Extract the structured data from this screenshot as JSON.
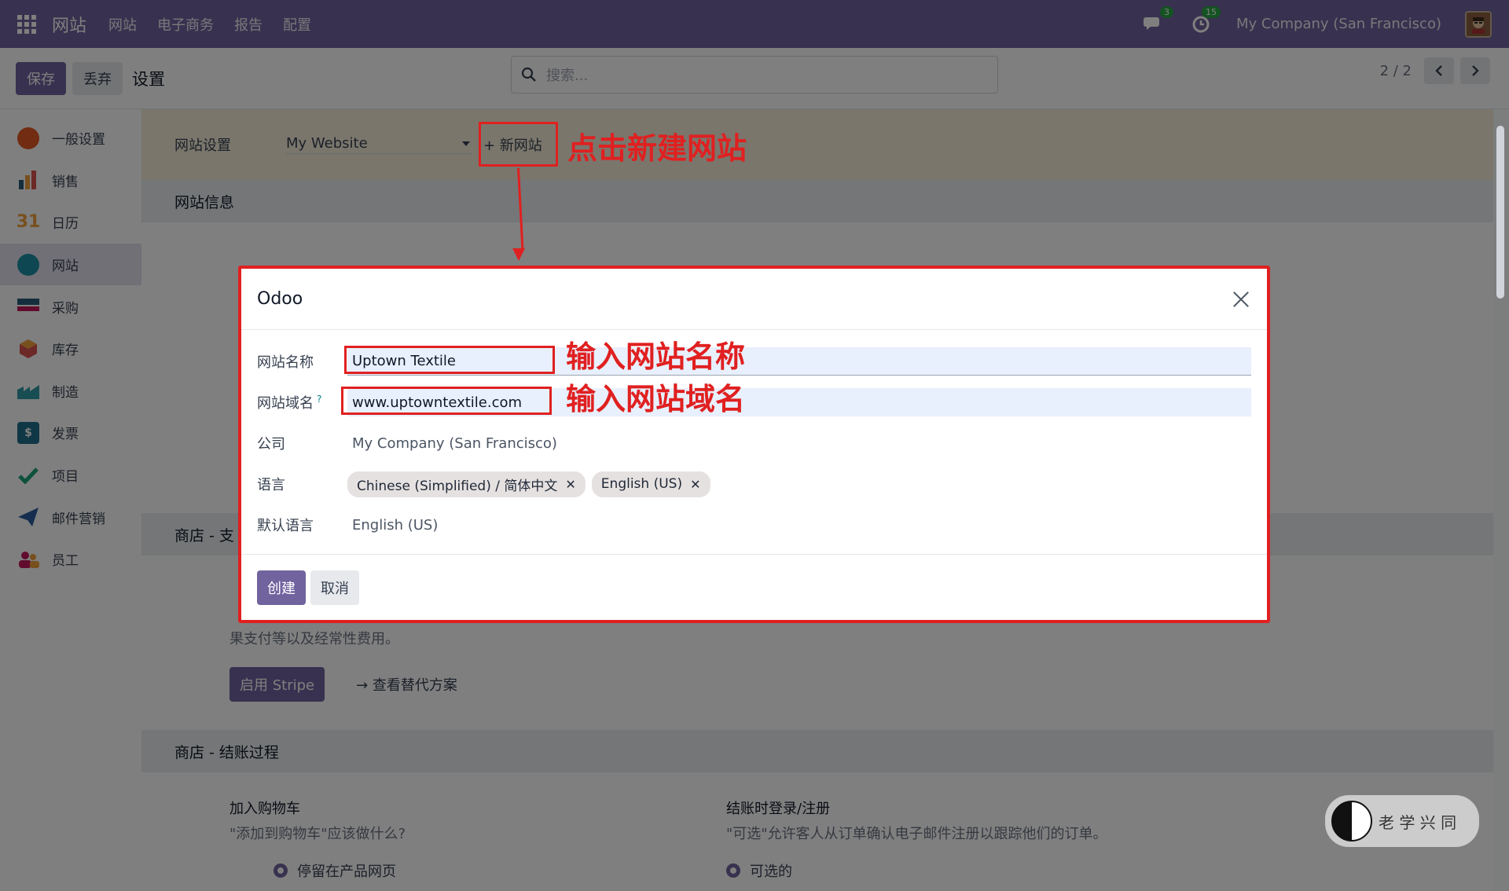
{
  "topbar": {
    "app_name": "网站",
    "menu": [
      "网站",
      "电子商务",
      "报告",
      "配置"
    ],
    "messages_count": "3",
    "activities_count": "15",
    "company": "My Company (San Francisco)"
  },
  "control_panel": {
    "save": "保存",
    "discard": "丢弃",
    "title": "设置",
    "search_placeholder": "搜索...",
    "pager": "2 / 2"
  },
  "sidebar": {
    "items": [
      {
        "label": "一般设置",
        "icon": "general-settings-icon",
        "color": "#e25822"
      },
      {
        "label": "销售",
        "icon": "sales-icon",
        "color": "#f0a03c"
      },
      {
        "label": "日历",
        "icon": "calendar-icon",
        "color": "#f0a03c"
      },
      {
        "label": "网站",
        "icon": "website-icon",
        "color": "#1d8fa3"
      },
      {
        "label": "采购",
        "icon": "purchase-icon",
        "color": "#2b5c7a"
      },
      {
        "label": "库存",
        "icon": "inventory-icon",
        "color": "#d9534f"
      },
      {
        "label": "制造",
        "icon": "manufacturing-icon",
        "color": "#2e9aa6"
      },
      {
        "label": "发票",
        "icon": "invoicing-icon",
        "color": "#1f6f8b"
      },
      {
        "label": "项目",
        "icon": "project-icon",
        "color": "#1aa37a"
      },
      {
        "label": "邮件营销",
        "icon": "email-marketing-icon",
        "color": "#2b5c9e"
      },
      {
        "label": "员工",
        "icon": "employees-icon",
        "color": "#c2185b"
      }
    ],
    "active_index": 3
  },
  "settings": {
    "header_label": "网站设置",
    "website_select": "My Website",
    "new_website": "+ 新网站",
    "section_info": "网站信息",
    "section_shop_pay": "商店 - 支",
    "pay_desc": "果支付等以及经常性费用。",
    "enable_stripe": "启用 Stripe",
    "see_alternatives": "查看替代方案",
    "section_checkout": "商店 - 结账过程",
    "add_to_cart_title": "加入购物车",
    "add_to_cart_desc": "\"添加到购物车\"应该做什么?",
    "add_to_cart_option": "停留在产品网页",
    "checkout_login_title": "结账时登录/注册",
    "checkout_login_desc": "\"可选\"允许客人从订单确认电子邮件注册以跟踪他们的订单。",
    "checkout_login_option": "可选的"
  },
  "dialog": {
    "title": "Odoo",
    "fields": {
      "name_label": "网站名称",
      "name_value": "Uptown Textile",
      "domain_label": "网站域名",
      "domain_help": "?",
      "domain_value": "www.uptowntextile.com",
      "company_label": "公司",
      "company_value": "My Company (San Francisco)",
      "language_label": "语言",
      "languages": [
        "Chinese (Simplified) / 简体中文",
        "English (US)"
      ],
      "default_language_label": "默认语言",
      "default_language_value": "English (US)"
    },
    "create": "创建",
    "cancel": "取消"
  },
  "annotations": {
    "click_new": "点击新建网站",
    "enter_name": "输入网站名称",
    "enter_domain": "输入网站域名"
  },
  "watermark_text": "老 学 兴 同",
  "colors": {
    "brand": "#71639e",
    "annotation": "#e02020",
    "badge": "#28a745"
  }
}
